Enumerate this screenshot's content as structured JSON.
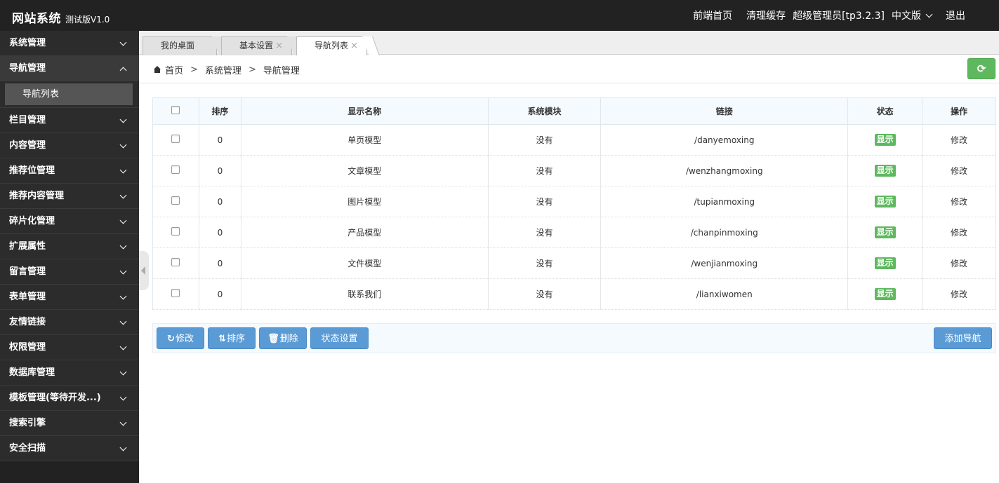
{
  "brand": {
    "title": "网站系统",
    "version": "测试版V1.0"
  },
  "topnav": {
    "frontpage": "前端首页",
    "clear_cache": "清理缓存",
    "user": "超级管理员[tp3.2.3]",
    "language": "中文版",
    "logout": "退出"
  },
  "sidebar": {
    "items": [
      {
        "label": "系统管理"
      },
      {
        "label": "导航管理"
      },
      {
        "label": "栏目管理"
      },
      {
        "label": "内容管理"
      },
      {
        "label": "推荐位管理"
      },
      {
        "label": "推荐内容管理"
      },
      {
        "label": "碎片化管理"
      },
      {
        "label": "扩展属性"
      },
      {
        "label": "留言管理"
      },
      {
        "label": "表单管理"
      },
      {
        "label": "友情链接"
      },
      {
        "label": "权限管理"
      },
      {
        "label": "数据库管理"
      },
      {
        "label": "模板管理(等待开发...)"
      },
      {
        "label": "搜索引擎"
      },
      {
        "label": "安全扫描"
      }
    ],
    "sub_items": [
      {
        "label": "导航列表"
      }
    ]
  },
  "tabs": [
    {
      "label": "我的桌面"
    },
    {
      "label": "基本设置",
      "close": "×"
    },
    {
      "label": "导航列表",
      "close": "×"
    }
  ],
  "breadcrumb": {
    "home": "首页",
    "sep": ">",
    "level1": "系统管理",
    "level2": "导航管理"
  },
  "refresh_icon": "refresh-icon",
  "table": {
    "headers": {
      "sort": "排序",
      "name": "显示名称",
      "module": "系统模块",
      "link": "链接",
      "status": "状态",
      "op": "操作"
    },
    "rows": [
      {
        "sort": "0",
        "name": "单页模型",
        "module": "没有",
        "link": "/danyemoxing",
        "status": "显示",
        "op": "修改"
      },
      {
        "sort": "0",
        "name": "文章模型",
        "module": "没有",
        "link": "/wenzhangmoxing",
        "status": "显示",
        "op": "修改"
      },
      {
        "sort": "0",
        "name": "图片模型",
        "module": "没有",
        "link": "/tupianmoxing",
        "status": "显示",
        "op": "修改"
      },
      {
        "sort": "0",
        "name": "产品模型",
        "module": "没有",
        "link": "/chanpinmoxing",
        "status": "显示",
        "op": "修改"
      },
      {
        "sort": "0",
        "name": "文件模型",
        "module": "没有",
        "link": "/wenjianmoxing",
        "status": "显示",
        "op": "修改"
      },
      {
        "sort": "0",
        "name": "联系我们",
        "module": "没有",
        "link": "/lianxiwomen",
        "status": "显示",
        "op": "修改"
      }
    ]
  },
  "toolbar": {
    "edit": "修改",
    "sort": "排序",
    "delete": "删除",
    "status": "状态设置",
    "add": "添加导航"
  },
  "colors": {
    "topbar": "#222222",
    "sidebar": "#2c2c2c",
    "primary_button": "#5b9bd5",
    "success": "#5eb95e"
  }
}
